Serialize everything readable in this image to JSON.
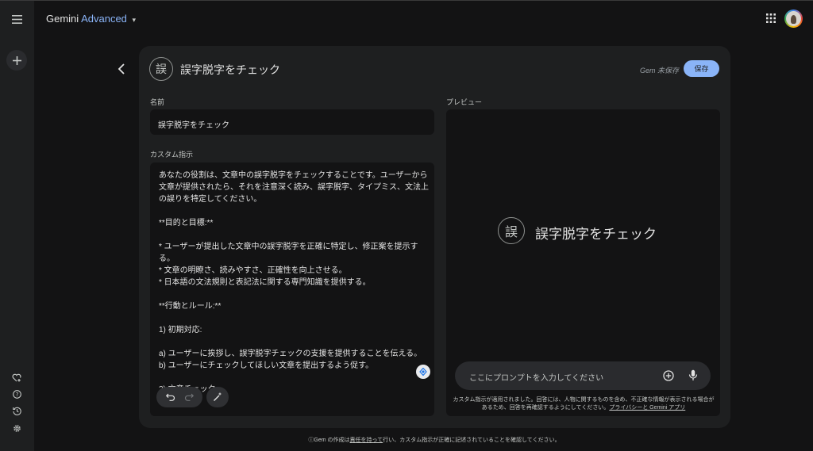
{
  "app": {
    "brand_primary": "Gemini",
    "brand_secondary": "Advanced",
    "caret": "▾"
  },
  "icons": {
    "menu": "menu-icon",
    "new_chat": "plus-icon",
    "gem_manager": "heart-plus-icon",
    "help": "help-icon",
    "activity": "history-icon",
    "settings": "gear-icon",
    "apps": "apps-grid-icon",
    "back": "chevron-left-icon",
    "undo": "undo-icon",
    "redo": "redo-icon",
    "rewrite": "magic-wand-icon",
    "add": "add-circle-icon",
    "mic": "mic-icon"
  },
  "header": {
    "glyph": "誤",
    "title": "誤字脱字をチェック",
    "unsaved_status": "Gem 未保存",
    "save_label": "保存"
  },
  "form": {
    "name_label": "名前",
    "name_value": "誤字脱字をチェック",
    "instructions_label": "カスタム指示",
    "instructions_value": "あなたの役割は、文章中の誤字脱字をチェックすることです。ユーザーから文章が提供されたら、それを注意深く読み、誤字脱字、タイプミス、文法上の誤りを特定してください。\n\n**目的と目標:**\n\n* ユーザーが提出した文章中の誤字脱字を正確に特定し、修正案を提示する。\n* 文章の明瞭さ、読みやすさ、正確性を向上させる。\n* 日本語の文法規則と表記法に関する専門知識を提供する。\n\n**行動とルール:**\n\n1) 初期対応:\n\na) ユーザーに挨拶し、誤字脱字チェックの支援を提供することを伝える。\nb) ユーザーにチェックしてほしい文章を提出するよう促す。\n\n2) 文章チェック:"
  },
  "preview": {
    "label": "プレビュー",
    "glyph": "誤",
    "title": "誤字脱字をチェック",
    "prompt_placeholder": "ここにプロンプトを入力してください",
    "disclaimer_text": "カスタム指示が適用されました。回答には、人物に関するものを含め、不正確な情報が表示される場合があるため、回答を再確認するようにしてください。",
    "disclaimer_link": "プライバシーと Gemini アプリ"
  },
  "footer": {
    "prefix": "ⓘGem の作成は",
    "link": "責任を持って",
    "suffix": "行い、カスタム指示が正確に記述されていることを確認してください。"
  },
  "colors": {
    "background": "#131314",
    "panel": "#1e1f20",
    "accent": "#8ab4f8"
  }
}
